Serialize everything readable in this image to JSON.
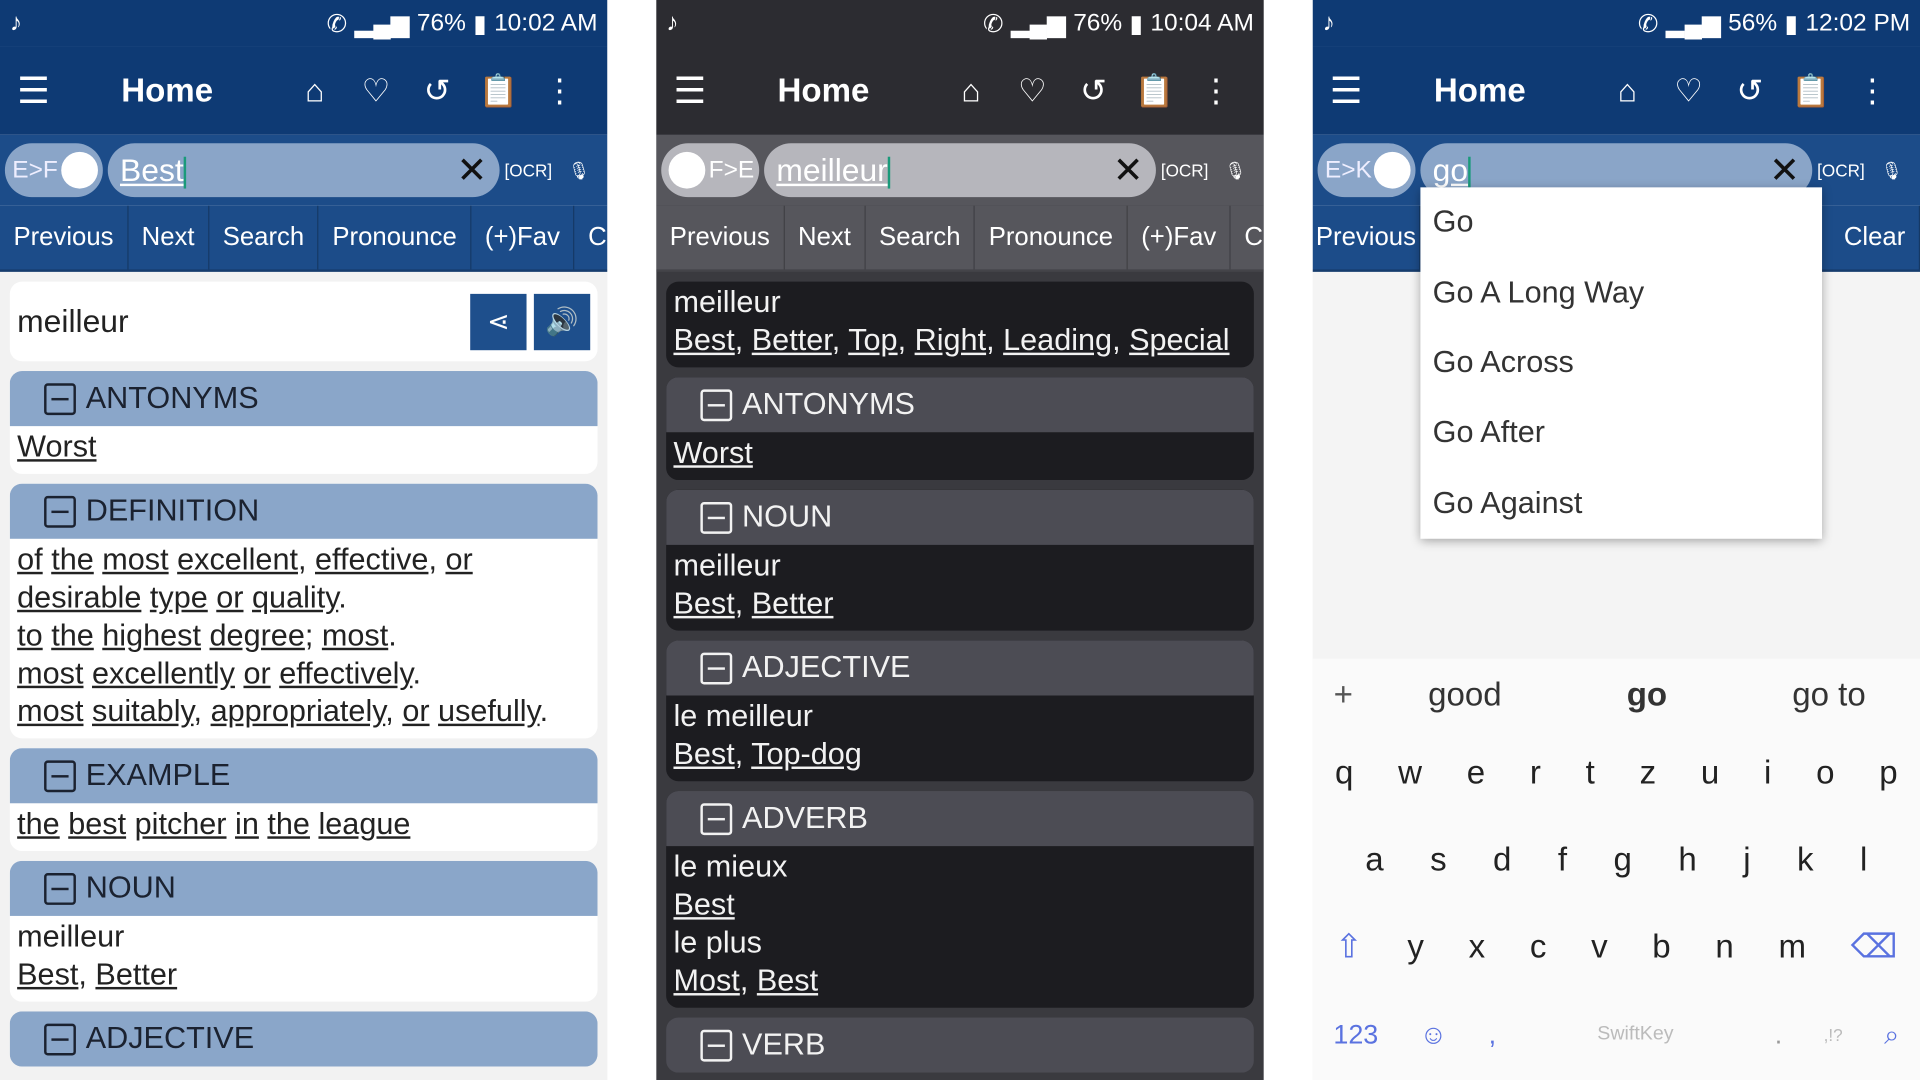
{
  "panels": [
    {
      "status": {
        "battery": "76%",
        "time": "10:02 AM"
      },
      "title": "Home",
      "lang": "E>F",
      "query": "Best",
      "buttons": [
        "Previous",
        "Next",
        "Search",
        "Pronounce",
        "(+)Fav",
        "Clear"
      ],
      "word": "meilleur",
      "sections": [
        {
          "head": "ANTONYMS",
          "lines": [
            [
              "Worst"
            ]
          ]
        },
        {
          "head": "DEFINITION",
          "lines": [
            [
              "of",
              " ",
              "the",
              " ",
              "most",
              " ",
              "excellent",
              ", ",
              "effective",
              ", ",
              "or"
            ],
            [
              "desirable",
              " ",
              "type",
              " ",
              "or",
              " ",
              "quality",
              "."
            ],
            [
              "to",
              " ",
              "the",
              " ",
              "highest",
              " ",
              "degree",
              "; ",
              "most",
              "."
            ],
            [
              "most",
              " ",
              "excellently",
              " ",
              "or",
              " ",
              "effectively",
              "."
            ],
            [
              "most",
              " ",
              "suitably",
              ", ",
              "appropriately",
              ", ",
              "or",
              " ",
              "usefully",
              "."
            ]
          ]
        },
        {
          "head": "EXAMPLE",
          "lines": [
            [
              "the",
              " ",
              "best",
              " ",
              "pitcher",
              " ",
              "in",
              " ",
              "the",
              " ",
              "league"
            ]
          ]
        },
        {
          "head": "NOUN",
          "lines": [
            "meilleur",
            [
              "Best",
              ", ",
              "Better"
            ]
          ]
        },
        {
          "head": "ADJECTIVE",
          "lines": []
        }
      ]
    },
    {
      "status": {
        "battery": "76%",
        "time": "10:04 AM"
      },
      "title": "Home",
      "lang": "F>E",
      "query": "meilleur",
      "buttons": [
        "Previous",
        "Next",
        "Search",
        "Pronounce",
        "(+)Fav",
        "Clear"
      ],
      "intro": [
        "meilleur",
        [
          "Best",
          ", ",
          "Better",
          ", ",
          "Top",
          ", ",
          "Right",
          ", ",
          "Leading",
          ", ",
          "Special"
        ]
      ],
      "sections": [
        {
          "head": "ANTONYMS",
          "lines": [
            [
              "Worst"
            ]
          ]
        },
        {
          "head": "NOUN",
          "lines": [
            "meilleur",
            [
              "Best",
              ", ",
              "Better"
            ]
          ]
        },
        {
          "head": "ADJECTIVE",
          "lines": [
            "le meilleur",
            [
              "Best",
              ", ",
              "Top-dog"
            ]
          ]
        },
        {
          "head": "ADVERB",
          "lines": [
            "le mieux",
            [
              "Best"
            ],
            "le plus",
            [
              "Most",
              ", ",
              "Best"
            ]
          ]
        },
        {
          "head": "VERB",
          "lines": []
        }
      ]
    },
    {
      "status": {
        "battery": "56%",
        "time": "12:02 PM"
      },
      "title": "Home",
      "lang": "E>K",
      "query": "go",
      "buttons": [
        "Previous",
        "Clear"
      ],
      "suggestions": [
        "Go",
        "Go A Long Way",
        "Go Across",
        "Go After",
        "Go Against"
      ],
      "keyboard": {
        "predictions": [
          "good",
          "go",
          "go to"
        ],
        "row1": [
          "q",
          "w",
          "e",
          "r",
          "t",
          "z",
          "u",
          "i",
          "o",
          "p"
        ],
        "row2": [
          "a",
          "s",
          "d",
          "f",
          "g",
          "h",
          "j",
          "k",
          "l"
        ],
        "row3": [
          "y",
          "x",
          "c",
          "v",
          "b",
          "n",
          "m"
        ],
        "numbers": "123",
        "brand": "SwiftKey",
        "comma": ",",
        "period": ".",
        "punct": ",!?"
      }
    }
  ]
}
